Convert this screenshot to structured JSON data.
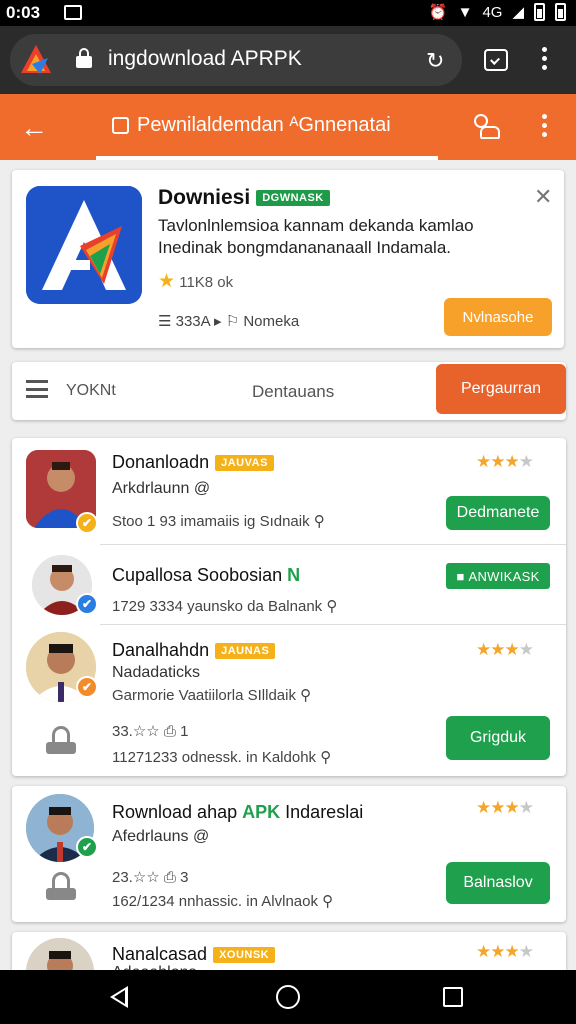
{
  "status_bar": {
    "time": "0:03",
    "signal_label": "4G"
  },
  "browser": {
    "url": "ingdownload APRPK"
  },
  "header": {
    "title": "Pewnilaldemdan ᴬGnnenatai"
  },
  "featured": {
    "title": "Downiesi",
    "badge": "DGWNASK",
    "description": "Tavlonlnlemsioa kannam dekanda kamlao Inedinak bongmdanananaall Indamala.",
    "rating_text": "11K8 ok",
    "meta_left": "333A",
    "meta_right": "Nomeka",
    "install_label": "Nvlnasohe"
  },
  "filter": {
    "left_label": "YOKNt",
    "center_label": "Dentauans",
    "button_label": "Pergaurran"
  },
  "items": [
    {
      "name": "Donanloadn",
      "badge": "JAUVAS",
      "sub": "Arkdrlaunn",
      "stats": "Stoo 1 93 imamaiis ig Sıdnaik",
      "rating": 3.5,
      "button": "Dedmanete",
      "verify_color": "#f4b11a"
    },
    {
      "name": "Cupallosa Soobosian",
      "badge": "ANWIKASK",
      "stats": "1729 3334 yaunsko da Balnank",
      "verify_color": "#2a7de1"
    },
    {
      "name": "Danalhahdn",
      "badge": "JAUNAS",
      "sub": "Nadadaticks",
      "stats": "Garmorie Vaatiilorla SIlldaik",
      "extra": "33.☆☆ ⎙ 1",
      "extra2": "11271233 odnessk. in Kaldohk",
      "rating": 3.5,
      "button": "Grigduk",
      "verify_color": "#f48a2a"
    },
    {
      "name_prefix": "Rownload ahap",
      "name_highlight": "APK",
      "name_suffix": "Indareslai",
      "sub": "Afedrlauns",
      "extra": "23.☆☆ ⎙ 3",
      "extra2": "162/1234 nnhassic. in Alvlnaok",
      "rating": 3,
      "button": "Balnaslov",
      "verify_color": "#1fa04c"
    },
    {
      "name": "Nanalcasad",
      "badge": "XOUNSK",
      "sub": "Adeaahlons",
      "rating": 3.5
    }
  ]
}
